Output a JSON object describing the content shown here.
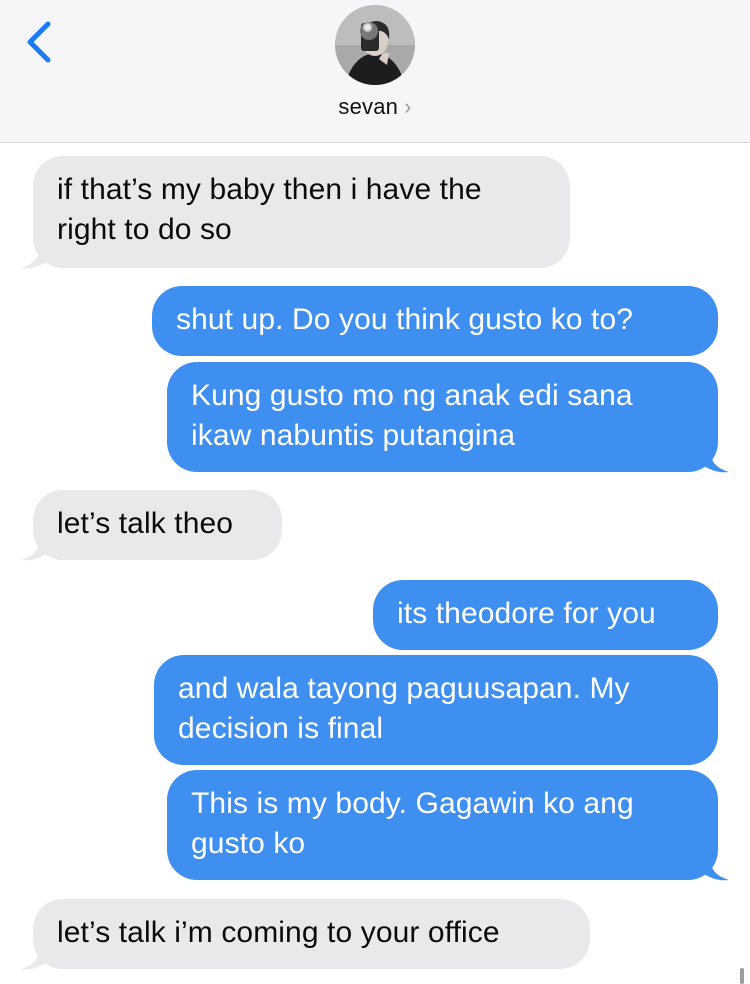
{
  "contact": {
    "name": "sevan",
    "chevron": "›",
    "avatar_icon": "avatar-photo"
  },
  "colors": {
    "sent": "#3f8ff0",
    "received": "#e9e9eb",
    "header": "#f6f6f8",
    "back": "#1a7cf5"
  },
  "messages": [
    {
      "direction": "received",
      "text": "if that’s my baby then i have the right to do so"
    },
    {
      "direction": "sent",
      "text": "shut up. Do you think gusto ko to?"
    },
    {
      "direction": "sent",
      "text": "Kung gusto mo ng anak edi sana ikaw nabuntis putangina"
    },
    {
      "direction": "received",
      "text": "let’s talk theo"
    },
    {
      "direction": "sent",
      "text": "its theodore for you"
    },
    {
      "direction": "sent",
      "text": "and wala tayong paguusapan. My decision is final"
    },
    {
      "direction": "sent",
      "text": "This is my body. Gagawin ko ang gusto ko"
    },
    {
      "direction": "received",
      "text": "let’s talk i’m coming to your office"
    }
  ]
}
